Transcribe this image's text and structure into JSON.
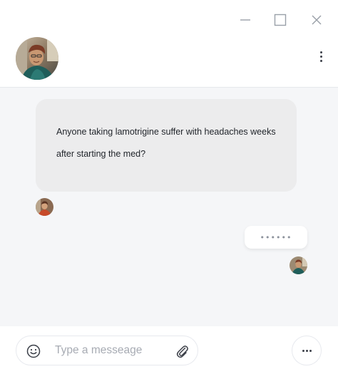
{
  "titlebar": {
    "minimize_icon": "minimize-icon",
    "maximize_icon": "maximize-icon",
    "close_icon": "close-icon"
  },
  "header": {
    "contact_avatar": "avatar",
    "menu_icon": "kebab-menu-icon"
  },
  "messages": [
    {
      "direction": "incoming",
      "text": "Anyone taking lamotrigine suffer with headaches weeks after starting the med?"
    },
    {
      "direction": "outgoing",
      "text": "••••••",
      "status": "typing"
    }
  ],
  "composer": {
    "placeholder": "Type a messeage",
    "value": "",
    "emoji_icon": "smiley-icon",
    "attach_icon": "paperclip-icon",
    "more_icon": "more-horizontal-icon"
  },
  "colors": {
    "chat_background": "#f5f6f8",
    "incoming_bubble": "#ececed",
    "outgoing_bubble": "#ffffff",
    "text": "#1f2329",
    "placeholder": "#a7abb3",
    "icon": "#3b3f48"
  }
}
